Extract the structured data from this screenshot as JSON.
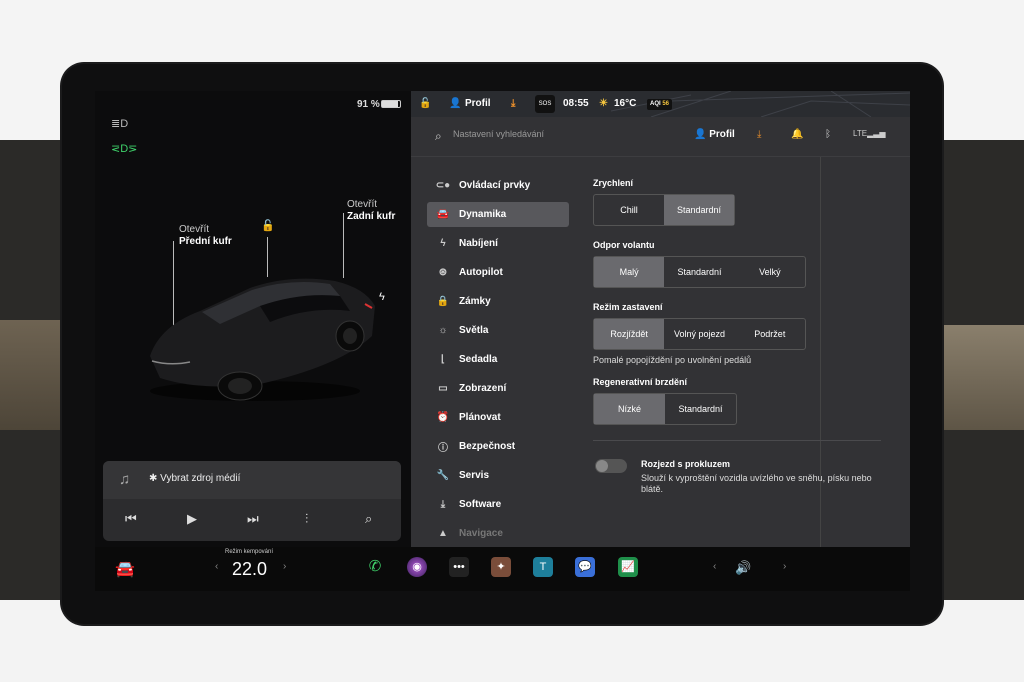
{
  "status_bar": {
    "battery_percent": "91 %",
    "profile_label": "Profil",
    "time": "08:55",
    "temperature": "16°C",
    "aqi_label": "AQI",
    "aqi_value": "56",
    "sos": "SOS"
  },
  "car_view": {
    "front_trunk_action": "Otevřít",
    "front_trunk_label": "Přední kufr",
    "rear_trunk_action": "Otevřít",
    "rear_trunk_label": "Zadní kufr"
  },
  "media": {
    "source_label": "✱ Vybrat zdroj médií"
  },
  "settings": {
    "search_placeholder": "Nastavení vyhledávání",
    "profile_label": "Profil",
    "menu": [
      {
        "label": "Ovládací prvky",
        "icon": "toggle-icon"
      },
      {
        "label": "Dynamika",
        "icon": "car-icon",
        "active": true
      },
      {
        "label": "Nabíjení",
        "icon": "bolt-icon"
      },
      {
        "label": "Autopilot",
        "icon": "steering-wheel-icon"
      },
      {
        "label": "Zámky",
        "icon": "lock-icon"
      },
      {
        "label": "Světla",
        "icon": "sun-icon"
      },
      {
        "label": "Sedadla",
        "icon": "seat-icon"
      },
      {
        "label": "Zobrazení",
        "icon": "display-icon"
      },
      {
        "label": "Plánovat",
        "icon": "alarm-clock-icon"
      },
      {
        "label": "Bezpečnost",
        "icon": "info-icon"
      },
      {
        "label": "Servis",
        "icon": "wrench-icon"
      },
      {
        "label": "Software",
        "icon": "download-icon"
      },
      {
        "label": "Navigace",
        "icon": "navigation-icon"
      }
    ],
    "acceleration": {
      "title": "Zrychlení",
      "options": [
        "Chill",
        "Standardní"
      ],
      "selected": "Standardní"
    },
    "steering": {
      "title": "Odpor volantu",
      "options": [
        "Malý",
        "Standardní",
        "Velký"
      ],
      "selected": "Malý"
    },
    "stopping": {
      "title": "Režim zastavení",
      "options": [
        "Rozjíždět",
        "Volný pojezd",
        "Podržet"
      ],
      "selected": "Rozjíždět",
      "note": "Pomalé popojíždění po uvolnění pedálů"
    },
    "regen": {
      "title": "Regenerativní brzdění",
      "options": [
        "Nízké",
        "Standardní"
      ],
      "selected": "Nízké"
    },
    "slip_start": {
      "title": "Rozjezd s prokluzem",
      "description": "Slouží k vyproštění vozidla uvízlého ve sněhu, písku nebo blátě.",
      "enabled": false
    }
  },
  "dock": {
    "climate_label": "Režim kempování",
    "temperature": "22.0",
    "apps": [
      "phone-icon",
      "camera-icon",
      "more-icon",
      "games-icon",
      "theater-icon",
      "messages-icon",
      "chart-app-icon"
    ]
  }
}
